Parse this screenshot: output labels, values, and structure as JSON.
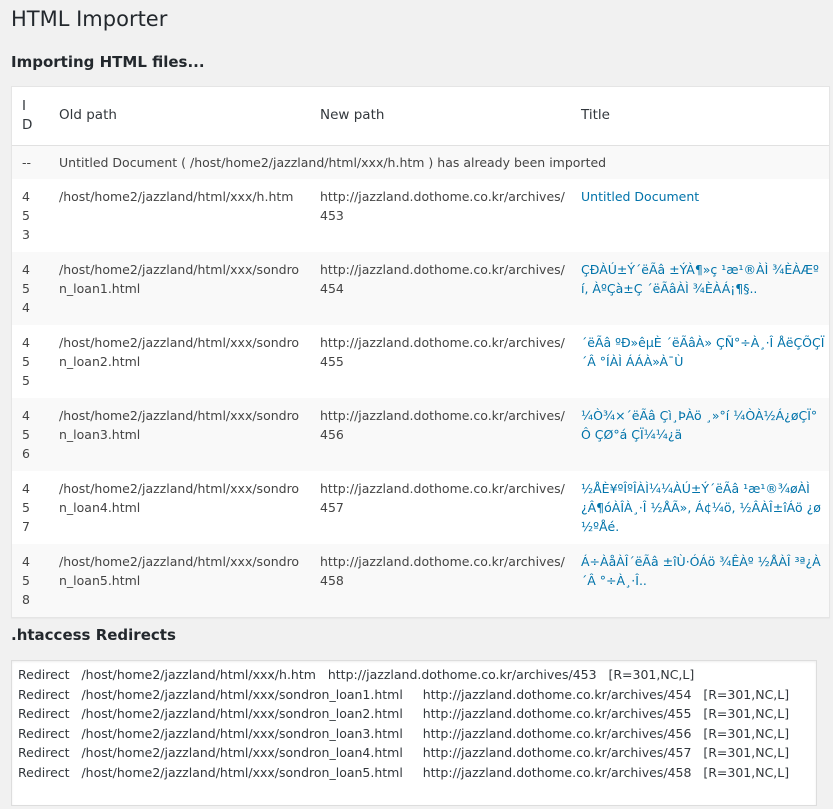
{
  "page": {
    "title": "HTML Importer"
  },
  "import_section": {
    "heading": "Importing HTML files..."
  },
  "table": {
    "headers": {
      "id": "ID",
      "old_path": "Old path",
      "new_path": "New path",
      "title": "Title"
    },
    "notice": {
      "marker": "--",
      "text": "Untitled Document ( /host/home2/jazzland/html/xxx/h.htm ) has already been imported"
    },
    "rows": [
      {
        "id": "453",
        "old_path": "/host/home2/jazzland/html/xxx/h.htm",
        "new_path": "http://jazzland.dothome.co.kr/archives/453",
        "title": "Untitled Document"
      },
      {
        "id": "454",
        "old_path": "/host/home2/jazzland/html/xxx/sondron_loan1.html",
        "new_path": "http://jazzland.dothome.co.kr/archives/454",
        "title": "ÇÐÀÚ±Ý´ëÃâ ±ÝÀ¶»ç ¹æ¹®ÀÌ ¾ÈÀÆºí, ÀºÇà±Ç ´ëÃâÀÌ ¾ÈÀÁ¡¶§.."
      },
      {
        "id": "455",
        "old_path": "/host/home2/jazzland/html/xxx/sondron_loan2.html",
        "new_path": "http://jazzland.dothome.co.kr/archives/455",
        "title": "´ëÃâ ºÐ»êµÈ ´ëÃâÀ» ÇÑ°÷À¸·Î ÅëÇÕÇÏ´Â °ÍÀÌ ÁÁÀ»À¯Ù"
      },
      {
        "id": "456",
        "old_path": "/host/home2/jazzland/html/xxx/sondron_loan3.html",
        "new_path": "http://jazzland.dothome.co.kr/archives/456",
        "title": "¼Ò¾×´ëÃâ Çì¸ÞÀö ¸»°í ¼ÒÀ½Á¿øÇÏ°Ô ÇØ°á ÇÏ¼¼¿ä"
      },
      {
        "id": "457",
        "old_path": "/host/home2/jazzland/html/xxx/sondron_loan4.html",
        "new_path": "http://jazzland.dothome.co.kr/archives/457",
        "title": "½ÅÈ¥ºÎºÎÀÌ¼¼ÀÚ±Ý´ëÃâ ¹æ¹®¾øÀÌ ¿Â¶óÀÎÀ¸·Î ½ÅÃ», Á¢¼ö, ½ÂÀÎ±îÁö ¿ø½ºÅé."
      },
      {
        "id": "458",
        "old_path": "/host/home2/jazzland/html/xxx/sondron_loan5.html",
        "new_path": "http://jazzland.dothome.co.kr/archives/458",
        "title": "Á÷ÀåÀÎ´ëÃâ ±îÙ·ÓÁö ¾ÊÀº ½ÅÀÎ ³ª¿À´Â °÷À¸·Î.."
      }
    ]
  },
  "htaccess_section": {
    "heading": ".htaccess Redirects",
    "lines": [
      "Redirect   /host/home2/jazzland/html/xxx/h.htm   http://jazzland.dothome.co.kr/archives/453   [R=301,NC,L]",
      "Redirect   /host/home2/jazzland/html/xxx/sondron_loan1.html     http://jazzland.dothome.co.kr/archives/454   [R=301,NC,L]",
      "Redirect   /host/home2/jazzland/html/xxx/sondron_loan2.html     http://jazzland.dothome.co.kr/archives/455   [R=301,NC,L]",
      "Redirect   /host/home2/jazzland/html/xxx/sondron_loan3.html     http://jazzland.dothome.co.kr/archives/456   [R=301,NC,L]",
      "Redirect   /host/home2/jazzland/html/xxx/sondron_loan4.html     http://jazzland.dothome.co.kr/archives/457   [R=301,NC,L]",
      "Redirect   /host/home2/jazzland/html/xxx/sondron_loan5.html     http://jazzland.dothome.co.kr/archives/458   [R=301,NC,L]"
    ]
  },
  "colors": {
    "link": "#0073aa",
    "background": "#f1f1f1"
  }
}
